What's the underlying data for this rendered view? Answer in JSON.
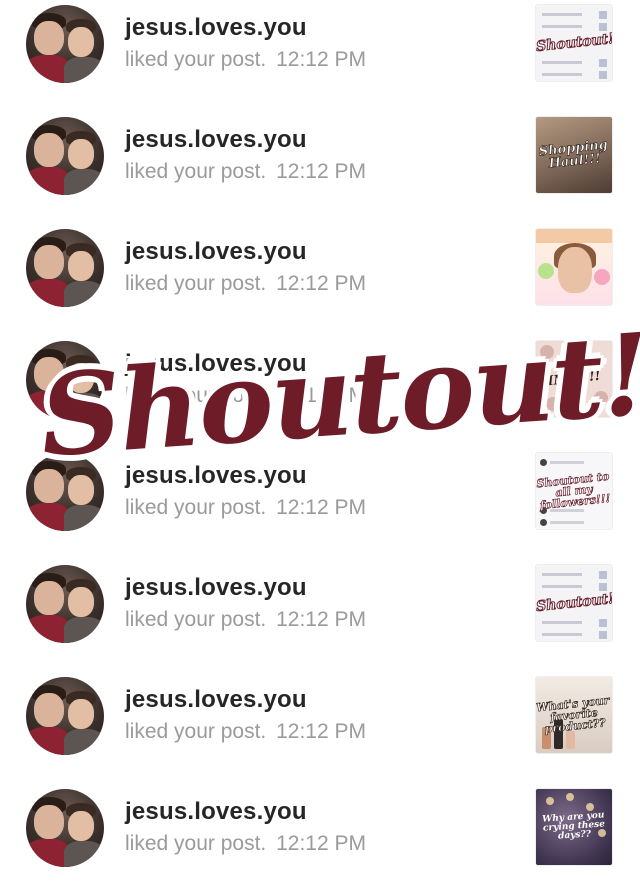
{
  "notifications": [
    {
      "username": "jesus.loves.you",
      "action": "liked your post.",
      "time": "12:12 PM",
      "thumbnail_text": "Shoutout!!!"
    },
    {
      "username": "jesus.loves.you",
      "action": "liked your post.",
      "time": "12:12 PM",
      "thumbnail_text": "Shopping Haul!!!"
    },
    {
      "username": "jesus.loves.you",
      "action": "liked your post.",
      "time": "12:12 PM",
      "thumbnail_text": ""
    },
    {
      "username": "jesus.loves.you",
      "action": "liked your post.",
      "time": "12:12 PM",
      "thumbnail_text": "IN ...!!!"
    },
    {
      "username": "jesus.loves.you",
      "action": "liked your post.",
      "time": "12:12 PM",
      "thumbnail_text": "Shoutout to all my followers!!!"
    },
    {
      "username": "jesus.loves.you",
      "action": "liked your post.",
      "time": "12:12 PM",
      "thumbnail_text": "Shoutout!!!"
    },
    {
      "username": "jesus.loves.you",
      "action": "liked your post.",
      "time": "12:12 PM",
      "thumbnail_text": "What's your favorite product??"
    },
    {
      "username": "jesus.loves.you",
      "action": "liked your post.",
      "time": "12:12 PM",
      "thumbnail_text": "Why are you crying these days??"
    }
  ],
  "overlay": {
    "text": "Shoutout!!!",
    "color": "#6e1c27"
  },
  "colors": {
    "username": "#262626",
    "secondary": "#9a9a9a",
    "background": "#ffffff"
  }
}
